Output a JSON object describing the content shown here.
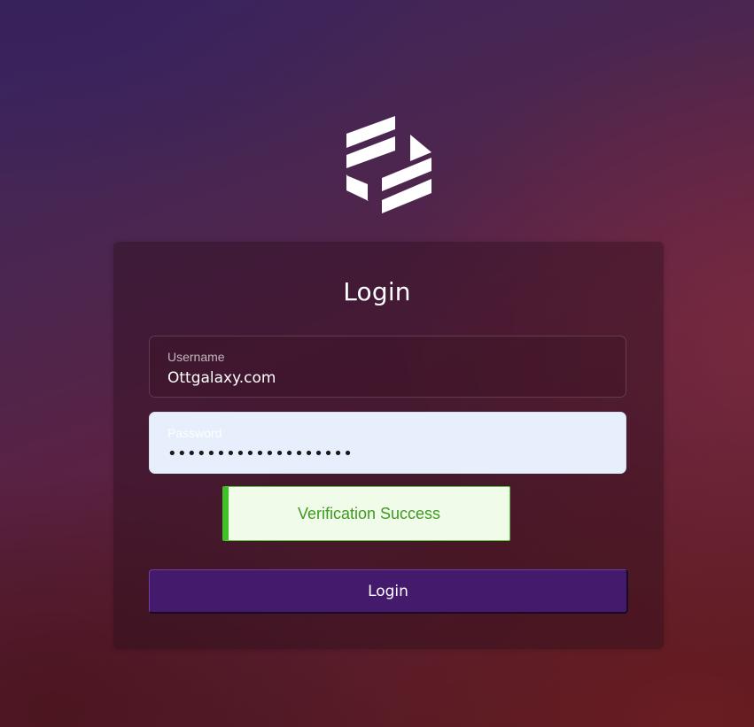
{
  "brand": {
    "logo_icon": "geometric-brand-logo-icon"
  },
  "login_form": {
    "title": "Login",
    "username": {
      "label": "Username",
      "value": "Ottgalaxy.com"
    },
    "password": {
      "label": "Password",
      "masked_value": "•••••••••••••••••••"
    },
    "verification": {
      "status_text": "Verification Success",
      "status": "success",
      "accent_color": "#3ec226"
    },
    "submit_label": "Login"
  },
  "colors": {
    "button_bg": "#441b6c",
    "password_bg": "#e8effc",
    "success_text": "#3f9a22"
  }
}
